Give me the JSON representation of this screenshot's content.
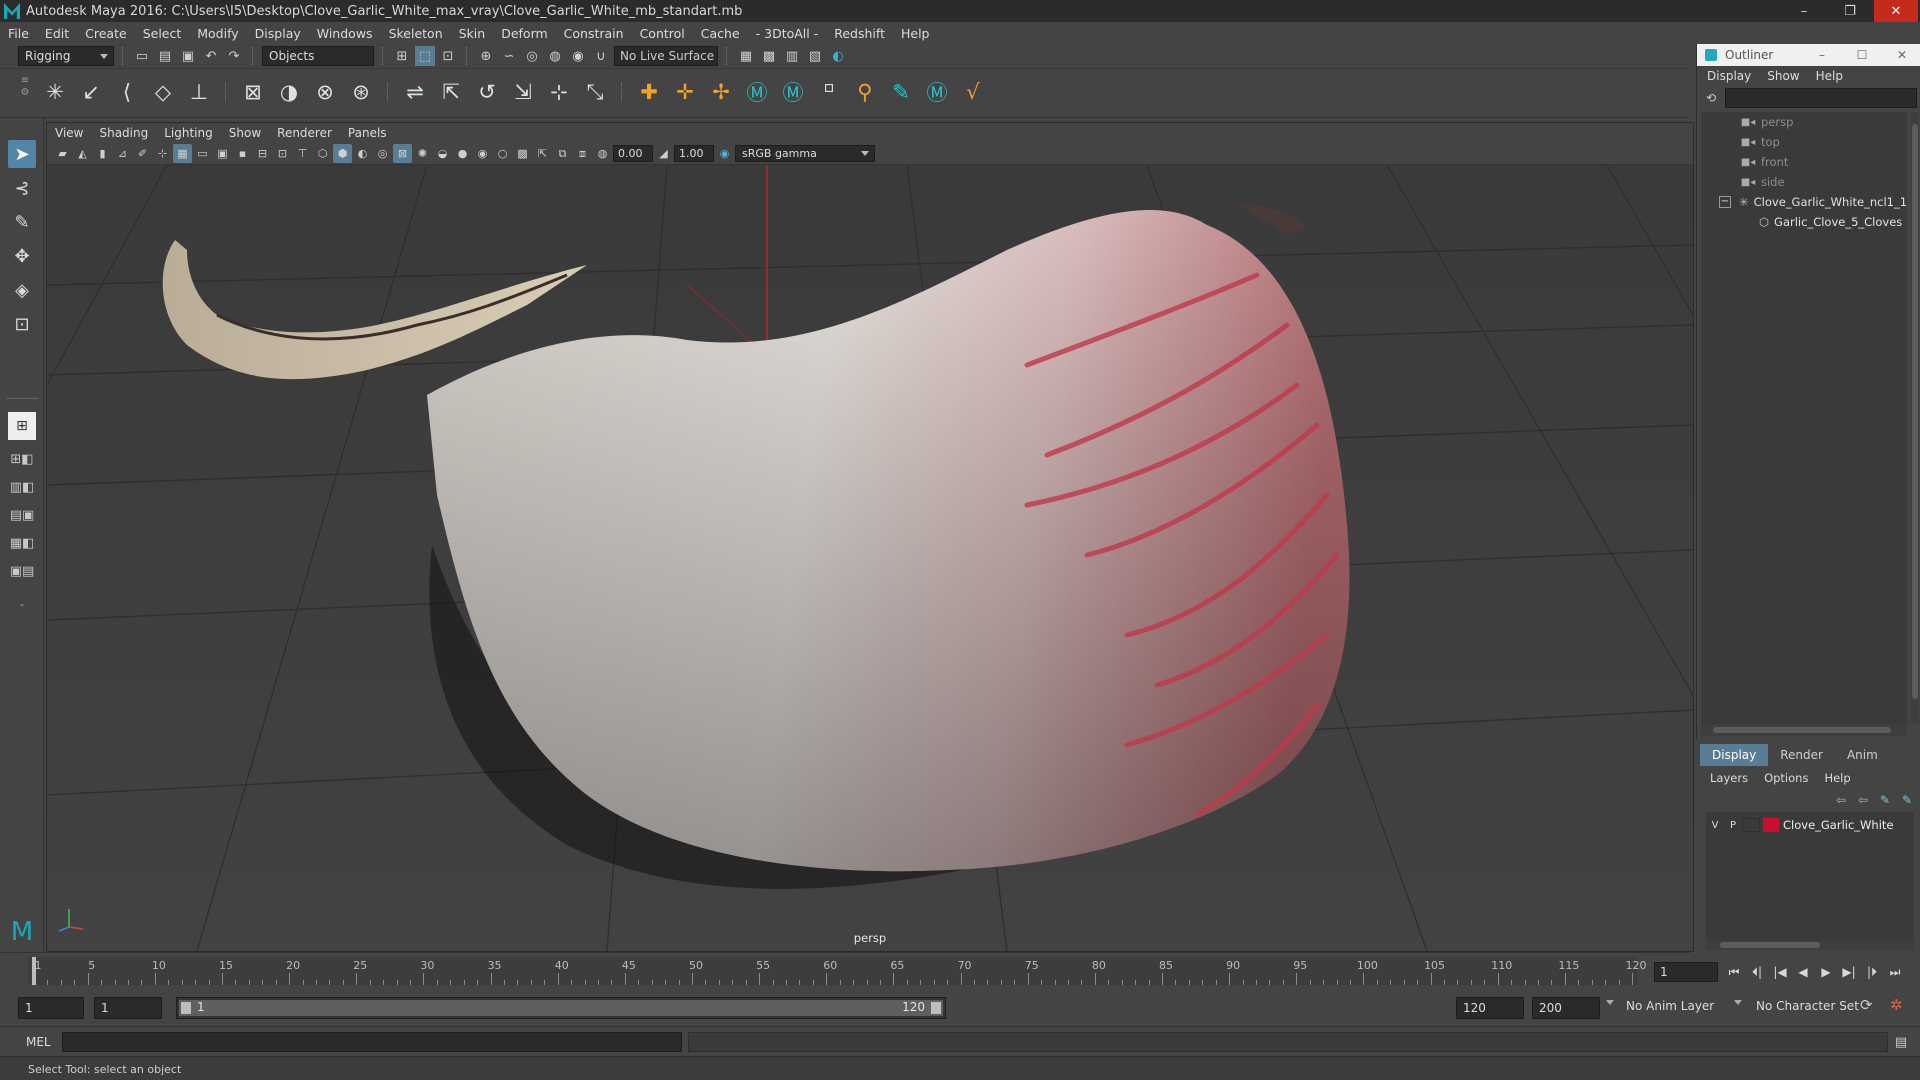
{
  "window": {
    "title": "Autodesk Maya 2016: C:\\Users\\I5\\Desktop\\Clove_Garlic_White_max_vray\\Clove_Garlic_White_mb_standart.mb",
    "minimize": "–",
    "maximize": "❐",
    "close": "✕"
  },
  "menu": [
    "File",
    "Edit",
    "Create",
    "Select",
    "Modify",
    "Display",
    "Windows",
    "Skeleton",
    "Skin",
    "Deform",
    "Constrain",
    "Control",
    "Cache",
    "- 3DtoAll -",
    "Redshift",
    "Help"
  ],
  "statusline": {
    "mode": "Rigging",
    "selection_mode": "Objects",
    "live_surface": "No Live Surface"
  },
  "viewport": {
    "menu": [
      "View",
      "Shading",
      "Lighting",
      "Show",
      "Renderer",
      "Panels"
    ],
    "exposure": "0.00",
    "gamma": "1.00",
    "color_space": "sRGB gamma",
    "camera_label": "persp"
  },
  "timeslider": {
    "ticks": [
      1,
      5,
      10,
      15,
      20,
      25,
      30,
      35,
      40,
      45,
      50,
      55,
      60,
      65,
      70,
      75,
      80,
      85,
      90,
      95,
      100,
      105,
      110,
      115,
      120
    ],
    "current_frame": "1"
  },
  "range": {
    "start": "1",
    "playback_start": "1",
    "slider_start": "1",
    "slider_end": "120",
    "playback_end": "120",
    "end": "200",
    "anim_layer": "No Anim Layer",
    "character_set": "No Character Set"
  },
  "cmdline": {
    "label": "MEL"
  },
  "helpline": "Select Tool: select an object",
  "outliner": {
    "title": "Outliner",
    "menu": [
      "Display",
      "Show",
      "Help"
    ],
    "items": [
      {
        "label": "persp"
      },
      {
        "label": "top"
      },
      {
        "label": "front"
      },
      {
        "label": "side"
      },
      {
        "label": "Clove_Garlic_White_ncl1_1"
      },
      {
        "label": "Garlic_Clove_5_Cloves"
      }
    ]
  },
  "layers": {
    "tabs": [
      "Display",
      "Render",
      "Anim"
    ],
    "menu": [
      "Layers",
      "Options",
      "Help"
    ],
    "rows": [
      {
        "visible": "V",
        "playback": "P",
        "name": "Clove_Garlic_White",
        "color": "#c8102e"
      }
    ]
  },
  "colors": {
    "ui_bg": "#444444",
    "accent_blue": "#5285a6",
    "maya_teal": "#1aa7b5",
    "close_red": "#c42b1c"
  }
}
